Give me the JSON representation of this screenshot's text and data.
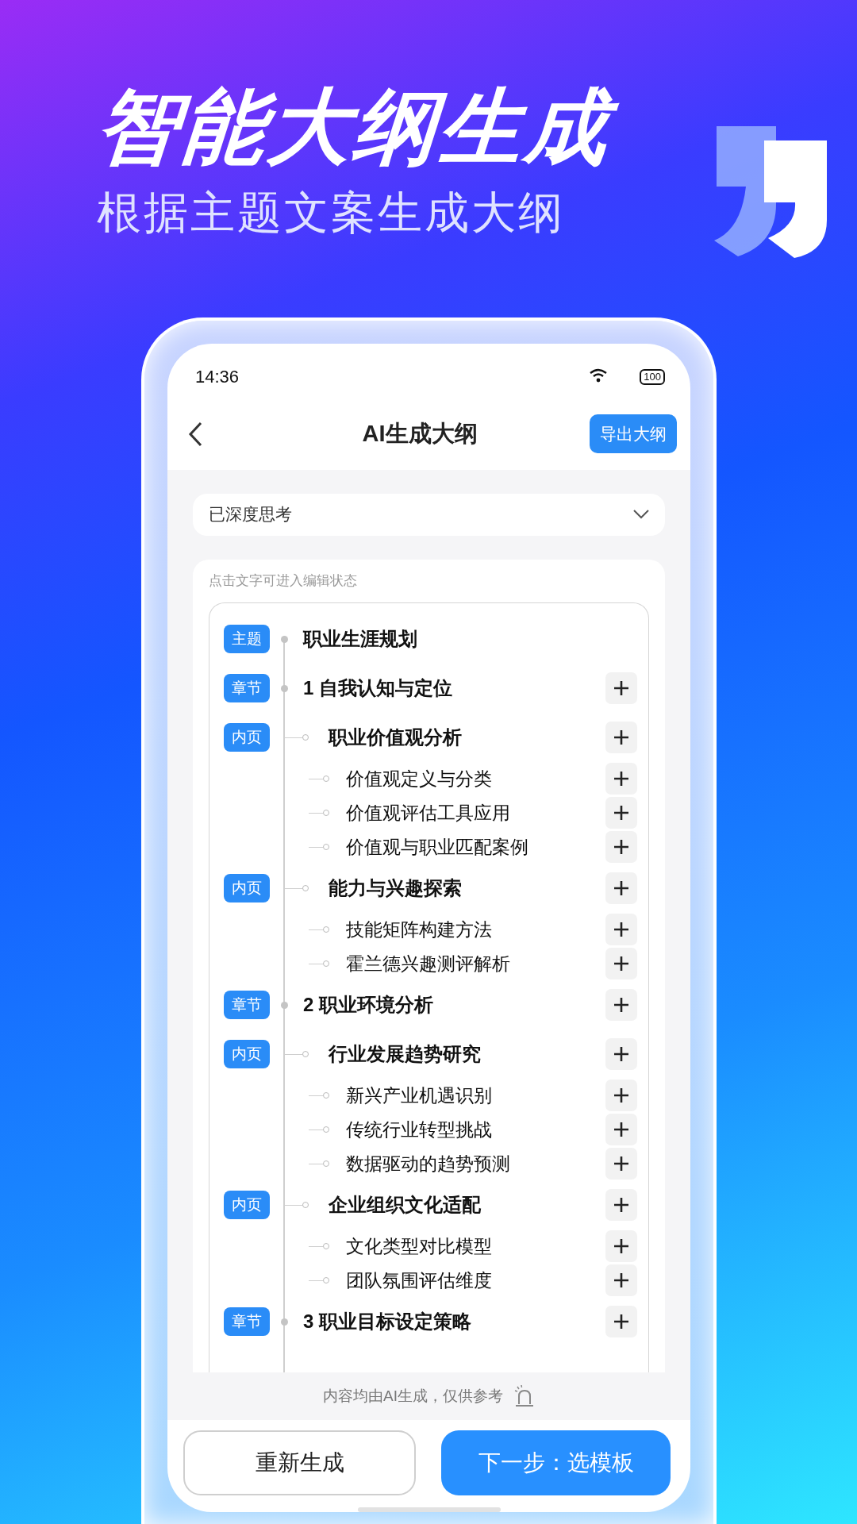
{
  "promo": {
    "title": "智能大纲生成",
    "subtitle": "根据主题文案生成大纲"
  },
  "status_bar": {
    "time": "14:36",
    "battery": "100"
  },
  "nav": {
    "title": "AI生成大纲",
    "export_button": "导出大纲"
  },
  "thinking": {
    "label": "已深度思考",
    "expanded": false
  },
  "outline": {
    "hint": "点击文字可进入编辑状态",
    "topic": {
      "tag": "主题",
      "title": "职业生涯规划"
    },
    "chapters": [
      {
        "tag": "章节",
        "title": "1 自我认知与定位",
        "children": [
          {
            "tag": "内页",
            "title": "职业价值观分析",
            "children": [
              {
                "title": "价值观定义与分类"
              },
              {
                "title": "价值观评估工具应用"
              },
              {
                "title": "价值观与职业匹配案例"
              }
            ]
          },
          {
            "tag": "内页",
            "title": "能力与兴趣探索",
            "children": [
              {
                "title": "技能矩阵构建方法"
              },
              {
                "title": "霍兰德兴趣测评解析"
              }
            ]
          }
        ]
      },
      {
        "tag": "章节",
        "title": "2 职业环境分析",
        "children": [
          {
            "tag": "内页",
            "title": "行业发展趋势研究",
            "children": [
              {
                "title": "新兴产业机遇识别"
              },
              {
                "title": "传统行业转型挑战"
              },
              {
                "title": "数据驱动的趋势预测"
              }
            ]
          },
          {
            "tag": "内页",
            "title": "企业组织文化适配",
            "children": [
              {
                "title": "文化类型对比模型"
              },
              {
                "title": "团队氛围评估维度"
              }
            ]
          }
        ]
      },
      {
        "tag": "章节",
        "title": "3 职业目标设定策略"
      }
    ]
  },
  "footer": {
    "disclaimer": "内容均由AI生成，仅供参考",
    "buttons": [
      {
        "label": "重新生成",
        "kind": "secondary"
      },
      {
        "label": "下一步：选模板",
        "kind": "primary"
      }
    ]
  }
}
